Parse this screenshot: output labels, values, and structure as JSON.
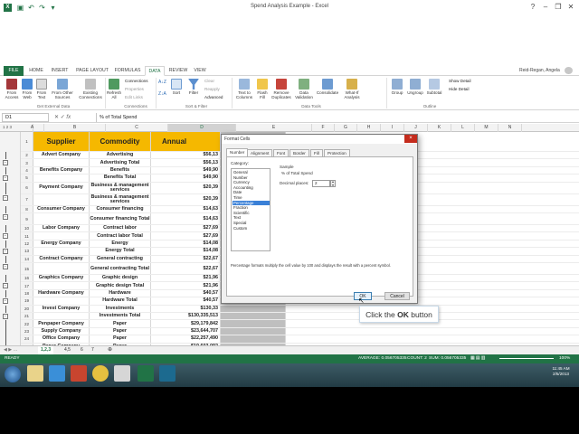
{
  "window": {
    "title": "Spend Analysis Example - Excel",
    "user": "Reid-Regan, Angela"
  },
  "tabs": [
    "FILE",
    "HOME",
    "INSERT",
    "PAGE LAYOUT",
    "FORMULAS",
    "DATA",
    "REVIEW",
    "VIEW"
  ],
  "active_tab": "DATA",
  "ribbon": {
    "get_external": [
      "From Access",
      "From Web",
      "From Text",
      "From Other Sources",
      "Existing Connections"
    ],
    "connections": {
      "refresh": "Refresh All",
      "items": [
        "Connections",
        "Properties",
        "Edit Links"
      ]
    },
    "sort_filter": {
      "sort_az": "A↓Z",
      "sort_za": "Z↓A",
      "sort": "Sort",
      "filter": "Filter",
      "items": [
        "Clear",
        "Reapply",
        "Advanced"
      ]
    },
    "data_tools": [
      "Text to Columns",
      "Flash Fill",
      "Remove Duplicates",
      "Data Validation",
      "Consolidate",
      "What-If Analysis"
    ],
    "outline": {
      "buttons": [
        "Group",
        "Ungroup",
        "Subtotal"
      ],
      "items": [
        "Show Detail",
        "Hide Detail"
      ]
    },
    "group_labels": {
      "get_external": "Get External Data",
      "connections": "Connections",
      "sort_filter": "Sort & Filter",
      "data_tools": "Data Tools",
      "outline": "Outline"
    }
  },
  "formula_bar": {
    "name_box": "D1",
    "fx": "fx",
    "formula": "% of Total Spend"
  },
  "columns": [
    "A",
    "B",
    "C",
    "D",
    "E",
    "F",
    "G",
    "H",
    "I",
    "J",
    "K",
    "L",
    "M",
    "N"
  ],
  "header_row": {
    "supplier": "Supplier",
    "commodity": "Commodity",
    "annual": "Annual",
    "pct": "% of Total Spend"
  },
  "rows": [
    {
      "n": "2",
      "supplier": "Advert Company",
      "commodity": "Advertising",
      "value": "$56,13"
    },
    {
      "n": "3",
      "supplier": "",
      "commodity": "Advertising Total",
      "value": "$56,13"
    },
    {
      "n": "4",
      "supplier": "Benefits Company",
      "commodity": "Benefits",
      "value": "$49,90"
    },
    {
      "n": "5",
      "supplier": "",
      "commodity": "Benefits Total",
      "value": "$49,90"
    },
    {
      "n": "6",
      "supplier": "Payment Company",
      "commodity": "Business & management services",
      "value": "$20,39"
    },
    {
      "n": "7",
      "supplier": "",
      "commodity": "Business & management services",
      "value": "$20,39"
    },
    {
      "n": "8",
      "supplier": "Consumer Company",
      "commodity": "Consumer financing",
      "value": "$14,63"
    },
    {
      "n": "9",
      "supplier": "",
      "commodity": "Consumer financing Total",
      "value": "$14,63"
    },
    {
      "n": "10",
      "supplier": "Labor Company",
      "commodity": "Contract labor",
      "value": "$27,69"
    },
    {
      "n": "11",
      "supplier": "",
      "commodity": "Contract labor Total",
      "value": "$27,69"
    },
    {
      "n": "12",
      "supplier": "Energy Company",
      "commodity": "Energy",
      "value": "$14,08"
    },
    {
      "n": "13",
      "supplier": "",
      "commodity": "Energy Total",
      "value": "$14,08"
    },
    {
      "n": "14",
      "supplier": "Contract Company",
      "commodity": "General contracting",
      "value": "$22,67"
    },
    {
      "n": "15",
      "supplier": "",
      "commodity": "General contracting Total",
      "value": "$22,67"
    },
    {
      "n": "16",
      "supplier": "Graphics Company",
      "commodity": "Graphic design",
      "value": "$21,96"
    },
    {
      "n": "17",
      "supplier": "",
      "commodity": "Graphic design Total",
      "value": "$21,96"
    },
    {
      "n": "18",
      "supplier": "Hardware Company",
      "commodity": "Hardware",
      "value": "$40,57"
    },
    {
      "n": "19",
      "supplier": "",
      "commodity": "Hardware Total",
      "value": "$40,57"
    },
    {
      "n": "20",
      "supplier": "Invest Company",
      "commodity": "Investments",
      "value": "$130,33"
    },
    {
      "n": "21",
      "supplier": "",
      "commodity": "Investments Total",
      "value": "$130,335,513"
    },
    {
      "n": "22",
      "supplier": "Penpaper Company",
      "commodity": "Paper",
      "value": "$29,179,842"
    },
    {
      "n": "23",
      "supplier": "Supply Company",
      "commodity": "Paper",
      "value": "$23,644,707"
    },
    {
      "n": "24",
      "supplier": "Office Company",
      "commodity": "Paper",
      "value": "$22,257,490"
    },
    {
      "n": "25",
      "supplier": "Paper Company",
      "commodity": "Paper",
      "value": "$19,603,092"
    },
    {
      "n": "26",
      "supplier": "",
      "commodity": "Paper Total",
      "value": "$94,684,131"
    }
  ],
  "sheet_tabs": [
    "1,2,3",
    "4,5",
    "6",
    "7"
  ],
  "status": {
    "ready": "READY",
    "average": "AVERAGE: 0.056705335",
    "count": "COUNT: 2",
    "sum": "SUM: 0.056705335",
    "zoom": "100%"
  },
  "dialog": {
    "title": "Format Cells",
    "close": "×",
    "tabs": [
      "Number",
      "Alignment",
      "Font",
      "Border",
      "Fill",
      "Protection"
    ],
    "category_label": "Category:",
    "categories": [
      "General",
      "Number",
      "Currency",
      "Accounting",
      "Date",
      "Time",
      "Percentage",
      "Fraction",
      "Scientific",
      "Text",
      "Special",
      "Custom"
    ],
    "selected_category": "Percentage",
    "sample_label": "Sample",
    "sample_value": "% of Total Spend",
    "decimal_label": "Decimal places:",
    "decimal_value": "2",
    "description": "Percentage formats multiply the cell value by 100 and displays the result with a percent symbol.",
    "ok": "OK",
    "cancel": "Cancel"
  },
  "callout": {
    "prefix": "Click the ",
    "bold": "OK",
    "suffix": " button"
  },
  "taskbar": {
    "time": "11:45 AM",
    "date": "2/5/2013"
  },
  "colors": {
    "excel_green": "#217346",
    "header_fill": "#f5b800",
    "selection": "#3a80d7"
  }
}
